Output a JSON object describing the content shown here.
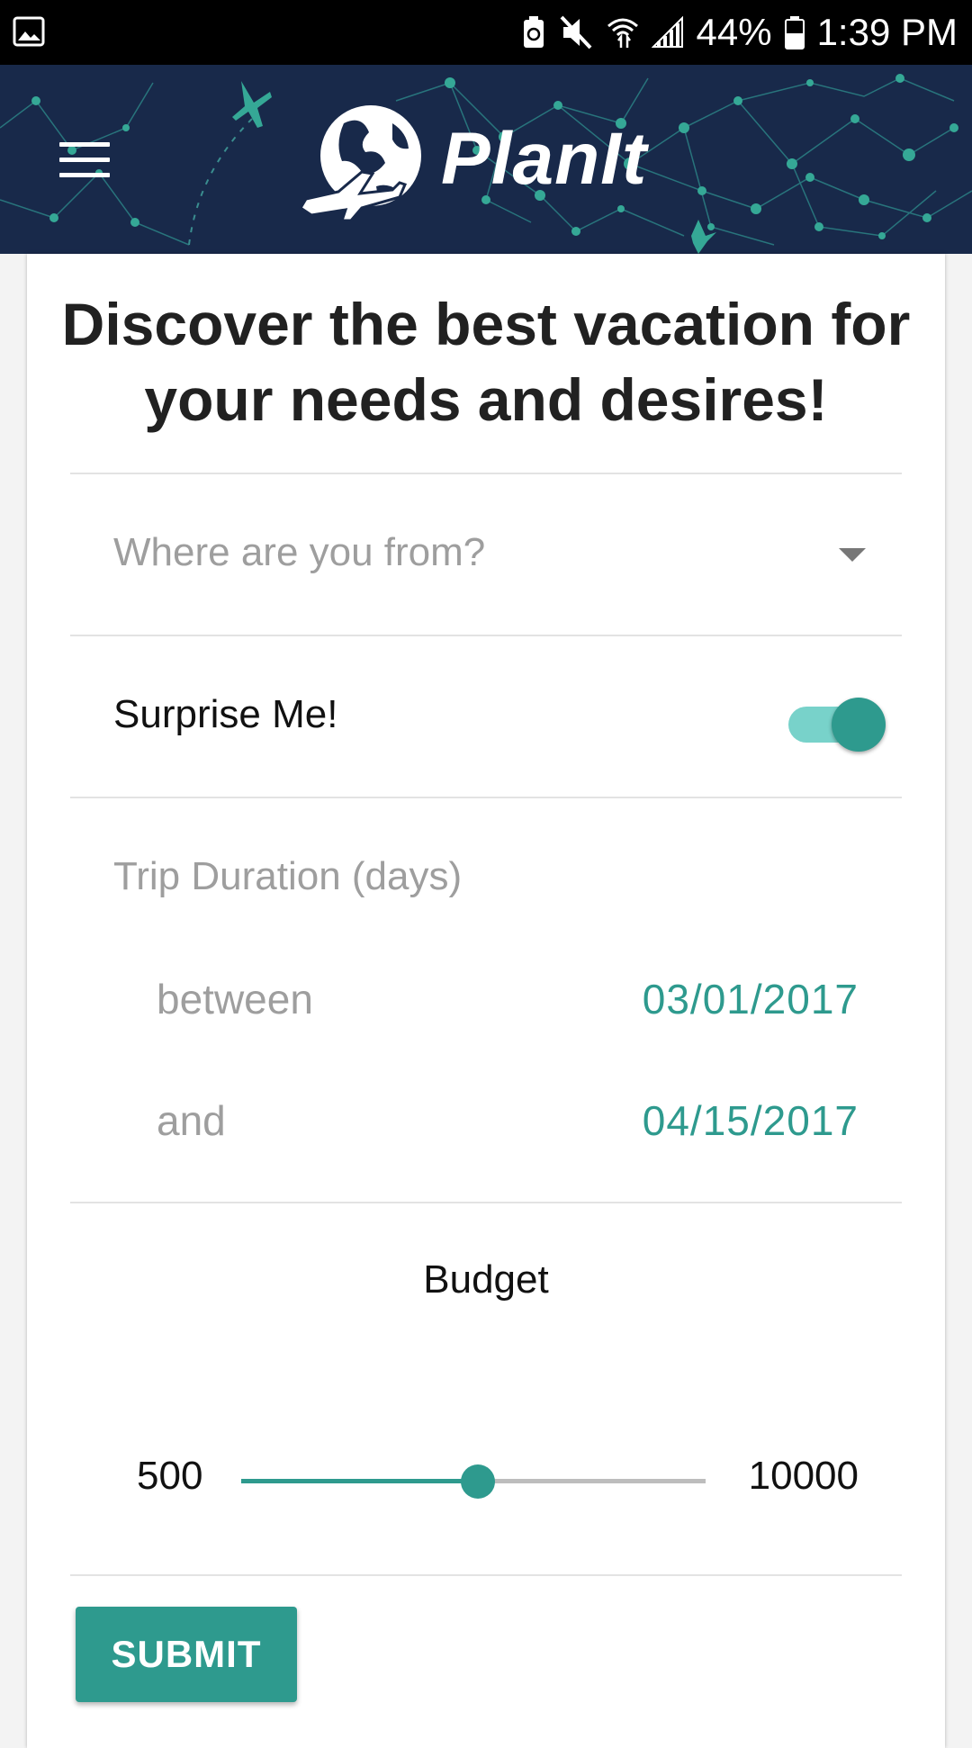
{
  "status_bar": {
    "battery": "44%",
    "time": "1:39 PM",
    "icons": [
      "gallery-icon",
      "battery-saver-icon",
      "mute-icon",
      "wifi-icon",
      "signal-icon",
      "battery-icon"
    ]
  },
  "header": {
    "app_name": "PlanIt",
    "menu_icon": "hamburger-menu-icon",
    "logo_icon": "globe-plane-icon",
    "background_color": "#18294a"
  },
  "form": {
    "title": "Discover the best vacation for your needs and desires!",
    "origin": {
      "placeholder": "Where are you from?"
    },
    "surprise": {
      "label": "Surprise Me!",
      "enabled": true
    },
    "duration": {
      "label": "Trip Duration (days)",
      "between_label": "between",
      "between_value": "03/01/2017",
      "and_label": "and",
      "and_value": "04/15/2017"
    },
    "budget": {
      "label": "Budget",
      "min": "500",
      "max": "10000",
      "level": 0.51
    },
    "submit_label": "SUBMIT"
  },
  "colors": {
    "accent": "#2e9a8e",
    "toggle_track": "#78d2ca",
    "placeholder_text": "#9e9e9e"
  }
}
